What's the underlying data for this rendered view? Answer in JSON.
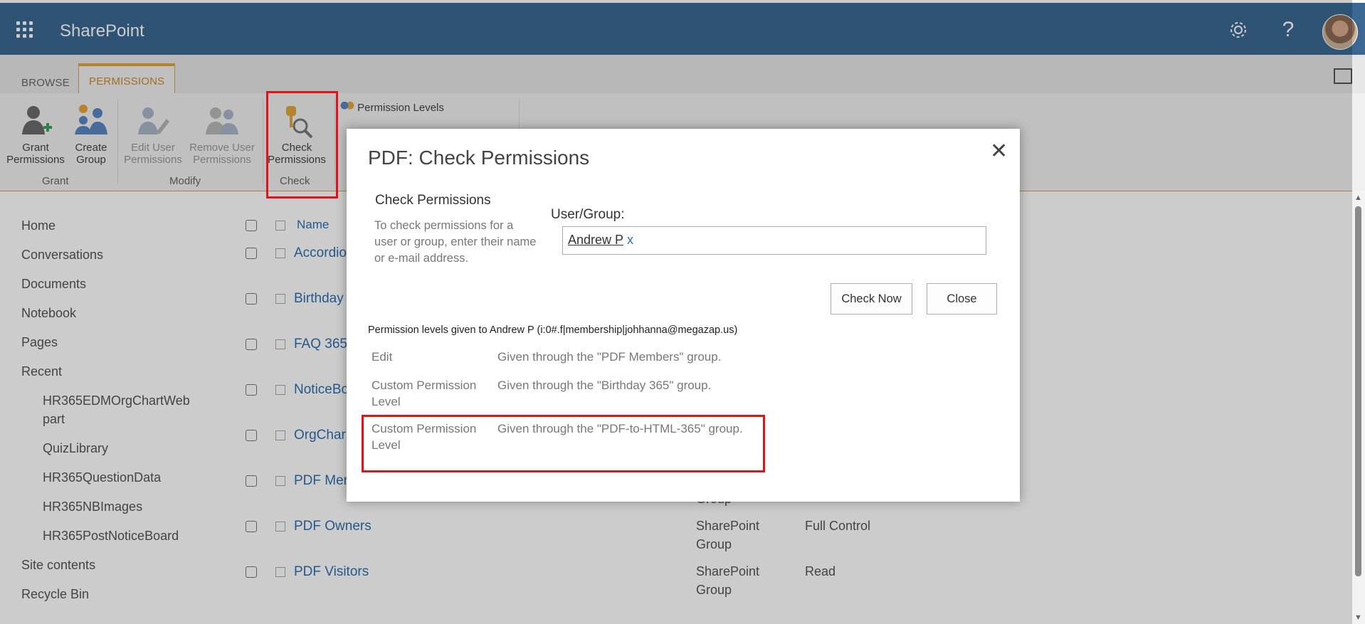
{
  "suitebar": {
    "brand": "SharePoint",
    "help_glyph": "?"
  },
  "ribbon": {
    "tabs": [
      "BROWSE",
      "PERMISSIONS"
    ],
    "buttons": {
      "grant": "Grant Permissions",
      "create_group": "Create Group",
      "edit_user": "Edit User Permissions",
      "remove_user": "Remove User Permissions",
      "check": "Check Permissions",
      "permission_levels": "Permission Levels"
    },
    "groups": [
      "Grant",
      "Modify",
      "Check"
    ]
  },
  "nav": {
    "items": [
      "Home",
      "Conversations",
      "Documents",
      "Notebook",
      "Pages",
      "Recent"
    ],
    "recent": [
      "HR365EDMOrgChartWebpart",
      "QuizLibrary",
      "HR365QuestionData",
      "HR365NBImages",
      "HR365PostNoticeBoard"
    ],
    "bottom": [
      "Site contents",
      "Recycle Bin"
    ]
  },
  "list": {
    "header_name": "Name",
    "rows": [
      {
        "name": "Accordio"
      },
      {
        "name": "Birthday"
      },
      {
        "name": "FAQ 365"
      },
      {
        "name": "NoticeBo"
      },
      {
        "name": "OrgChar"
      },
      {
        "name": "PDF Mer",
        "type": "Group"
      },
      {
        "name": "PDF Owners",
        "type": "SharePoint Group",
        "level": "Full Control"
      },
      {
        "name": "PDF Visitors",
        "type": "SharePoint Group",
        "level": "Read"
      }
    ]
  },
  "dialog": {
    "title": "PDF: Check Permissions",
    "close_glyph": "✕",
    "section_title": "Check Permissions",
    "section_desc": "To check permissions for a user or group, enter their name or e-mail address.",
    "user_group_label": "User/Group:",
    "user_value": "Andrew P",
    "remove_glyph": "x",
    "check_now": "Check Now",
    "close": "Close",
    "given_to": "Permission levels given to Andrew P (i:0#.f|membership|johhanna@megazap.us)",
    "permissions": [
      {
        "level": "Edit",
        "desc": "Given through the \"PDF Members\" group."
      },
      {
        "level": "Custom Permission Level",
        "desc": "Given through the \"Birthday 365\" group."
      },
      {
        "level": "Custom Permission Level",
        "desc": "Given through the \"PDF-to-HTML-365\" group."
      }
    ]
  },
  "colors": {
    "suitebar": "#3b6893",
    "accent": "#e2a43a",
    "link": "#2f6fb0",
    "highlight": "#e0131b"
  }
}
